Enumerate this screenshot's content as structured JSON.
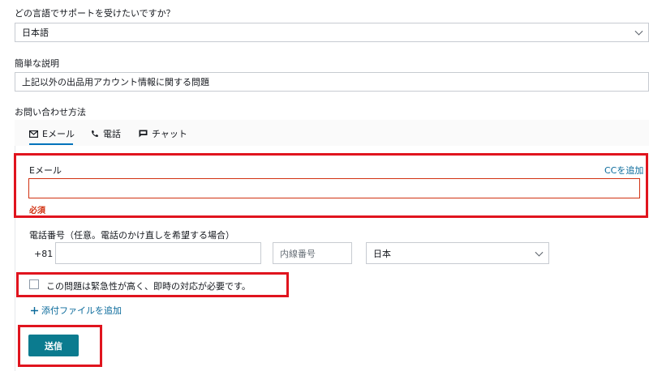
{
  "language": {
    "question": "どの言語でサポートを受けたいですか？",
    "value": "日本語"
  },
  "summary": {
    "label": "簡単な説明",
    "value": "上記以外の出品用アカウント情報に関する問題"
  },
  "contact": {
    "label": "お問い合わせ方法",
    "tabs": [
      {
        "label": "Eメール",
        "icon": "mail-icon"
      },
      {
        "label": "電話",
        "icon": "phone-icon"
      },
      {
        "label": "チャット",
        "icon": "chat-icon"
      }
    ]
  },
  "email": {
    "label": "Eメール",
    "add_cc": "CCを追加",
    "value": "",
    "required": "必須"
  },
  "phone": {
    "label": "電話番号（任意。電話のかけ直しを希望する場合）",
    "prefix": "+81",
    "number": "",
    "extension_placeholder": "内線番号",
    "country": "日本"
  },
  "urgent": {
    "label": "この問題は緊急性が高く、即時の対応が必要です。",
    "checked": false
  },
  "attach": {
    "label": "添付ファイルを追加"
  },
  "submit": {
    "label": "送信"
  },
  "colors": {
    "accent": "#0b7b8f",
    "highlight": "#e0141e",
    "link": "#0a6a9b",
    "required": "#d13212"
  }
}
